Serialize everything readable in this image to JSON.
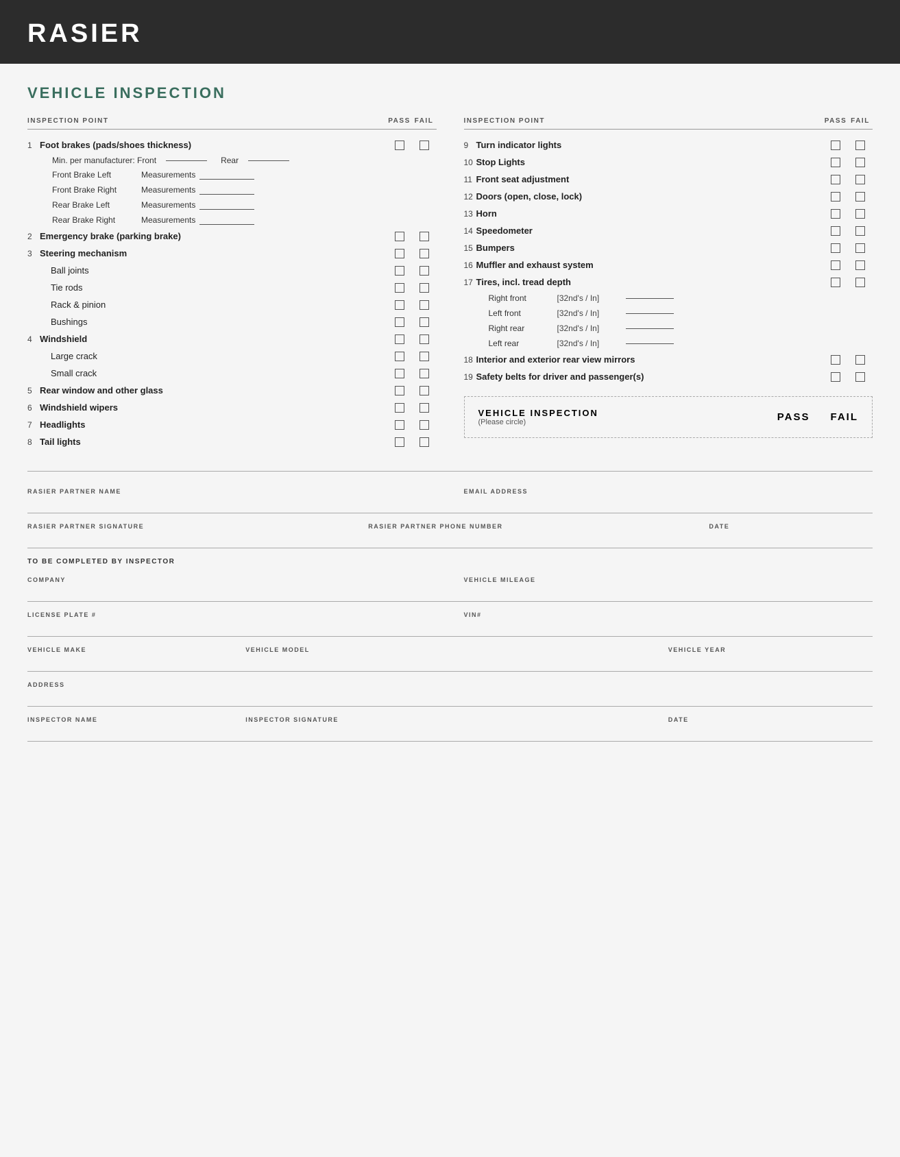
{
  "header": {
    "title": "RASIER"
  },
  "main": {
    "section_title": "VEHICLE INSPECTION",
    "left_col": {
      "header": {
        "label": "INSPECTION POINT",
        "pass": "PASS",
        "fail": "FAIL"
      },
      "items": [
        {
          "number": "1",
          "label": "Foot brakes (pads/shoes thickness)",
          "bold": true,
          "has_checkbox": true,
          "sub_items": [
            {
              "type": "min_mfg",
              "front_label": "Min. per manufacturer:  Front",
              "rear_label": "Rear"
            },
            {
              "type": "measurement",
              "label": "Front Brake Left",
              "text": "Measurements"
            },
            {
              "type": "measurement",
              "label": "Front Brake Right",
              "text": "Measurements"
            },
            {
              "type": "measurement",
              "label": "Rear Brake Left",
              "text": "Measurements"
            },
            {
              "type": "measurement",
              "label": "Rear Brake Right",
              "text": "Measurements"
            }
          ]
        },
        {
          "number": "2",
          "label": "Emergency brake (parking brake)",
          "bold": true,
          "has_checkbox": true
        },
        {
          "number": "3",
          "label": "Steering mechanism",
          "bold": true,
          "has_checkbox": true,
          "sub_items": [
            {
              "type": "checkbox_item",
              "label": "Ball joints"
            },
            {
              "type": "checkbox_item",
              "label": "Tie rods"
            },
            {
              "type": "checkbox_item",
              "label": "Rack & pinion"
            },
            {
              "type": "checkbox_item",
              "label": "Bushings"
            }
          ]
        },
        {
          "number": "4",
          "label": "Windshield",
          "bold": true,
          "has_checkbox": true,
          "sub_items": [
            {
              "type": "checkbox_item",
              "label": "Large crack"
            },
            {
              "type": "checkbox_item",
              "label": "Small crack"
            }
          ]
        },
        {
          "number": "5",
          "label": "Rear window and other glass",
          "bold": true,
          "has_checkbox": true
        },
        {
          "number": "6",
          "label": "Windshield wipers",
          "bold": true,
          "has_checkbox": true
        },
        {
          "number": "7",
          "label": "Headlights",
          "bold": true,
          "has_checkbox": true
        },
        {
          "number": "8",
          "label": "Tail lights",
          "bold": true,
          "has_checkbox": true
        }
      ]
    },
    "right_col": {
      "header": {
        "label": "INSPECTION POINT",
        "pass": "PASS",
        "fail": "FAIL"
      },
      "items": [
        {
          "number": "9",
          "label": "Turn indicator lights",
          "bold": true,
          "has_checkbox": true
        },
        {
          "number": "10",
          "label": "Stop Lights",
          "bold": true,
          "has_checkbox": true
        },
        {
          "number": "11",
          "label": "Front seat adjustment",
          "bold": true,
          "has_checkbox": true
        },
        {
          "number": "12",
          "label": "Doors (open, close, lock)",
          "bold": true,
          "has_checkbox": true
        },
        {
          "number": "13",
          "label": "Horn",
          "bold": true,
          "has_checkbox": true
        },
        {
          "number": "14",
          "label": "Speedometer",
          "bold": true,
          "has_checkbox": true
        },
        {
          "number": "15",
          "label": "Bumpers",
          "bold": true,
          "has_checkbox": true
        },
        {
          "number": "16",
          "label": "Muffler and exhaust system",
          "bold": true,
          "has_checkbox": true
        },
        {
          "number": "17",
          "label": "Tires, incl. tread depth",
          "bold": true,
          "has_checkbox": true,
          "sub_items": [
            {
              "type": "tread",
              "label": "Right front",
              "unit": "[32nd's / In]"
            },
            {
              "type": "tread",
              "label": "Left front",
              "unit": "[32nd's / In]"
            },
            {
              "type": "tread",
              "label": "Right rear",
              "unit": "[32nd's / In]"
            },
            {
              "type": "tread",
              "label": "Left rear",
              "unit": "[32nd's / In]"
            }
          ]
        },
        {
          "number": "18",
          "label": "Interior and exterior rear view mirrors",
          "bold": true,
          "has_checkbox": true
        },
        {
          "number": "19",
          "label": "Safety belts for driver and passenger(s)",
          "bold": true,
          "has_checkbox": true
        }
      ],
      "summary": {
        "title": "VEHICLE INSPECTION",
        "sub": "(Please circle)",
        "pass": "PASS",
        "fail": "FAIL"
      }
    }
  },
  "form": {
    "to_be_completed": "TO BE COMPLETED BY INSPECTOR",
    "rows": [
      {
        "fields": [
          {
            "label": "RASIER PARTNER NAME",
            "wide": true
          },
          {
            "label": "EMAIL ADDRESS",
            "wide": true
          }
        ]
      },
      {
        "fields": [
          {
            "label": "RASIER PARTNER SIGNATURE"
          },
          {
            "label": "RASIER PARTNER PHONE NUMBER"
          },
          {
            "label": "DATE",
            "narrow": true
          }
        ]
      },
      {
        "fields": [
          {
            "label": "COMPANY"
          },
          {
            "label": "VEHICLE MILEAGE"
          }
        ]
      },
      {
        "fields": [
          {
            "label": "LICENSE PLATE #"
          },
          {
            "label": "VIN#"
          }
        ]
      },
      {
        "fields": [
          {
            "label": "VEHICLE MAKE"
          },
          {
            "label": "VEHICLE MODEL"
          },
          {
            "label": "VEHICLE YEAR"
          }
        ]
      },
      {
        "fields": [
          {
            "label": "ADDRESS",
            "wide": true
          }
        ]
      },
      {
        "fields": [
          {
            "label": "INSPECTOR NAME"
          },
          {
            "label": "INSPECTOR SIGNATURE"
          },
          {
            "label": "DATE",
            "narrow": true
          }
        ]
      }
    ]
  }
}
